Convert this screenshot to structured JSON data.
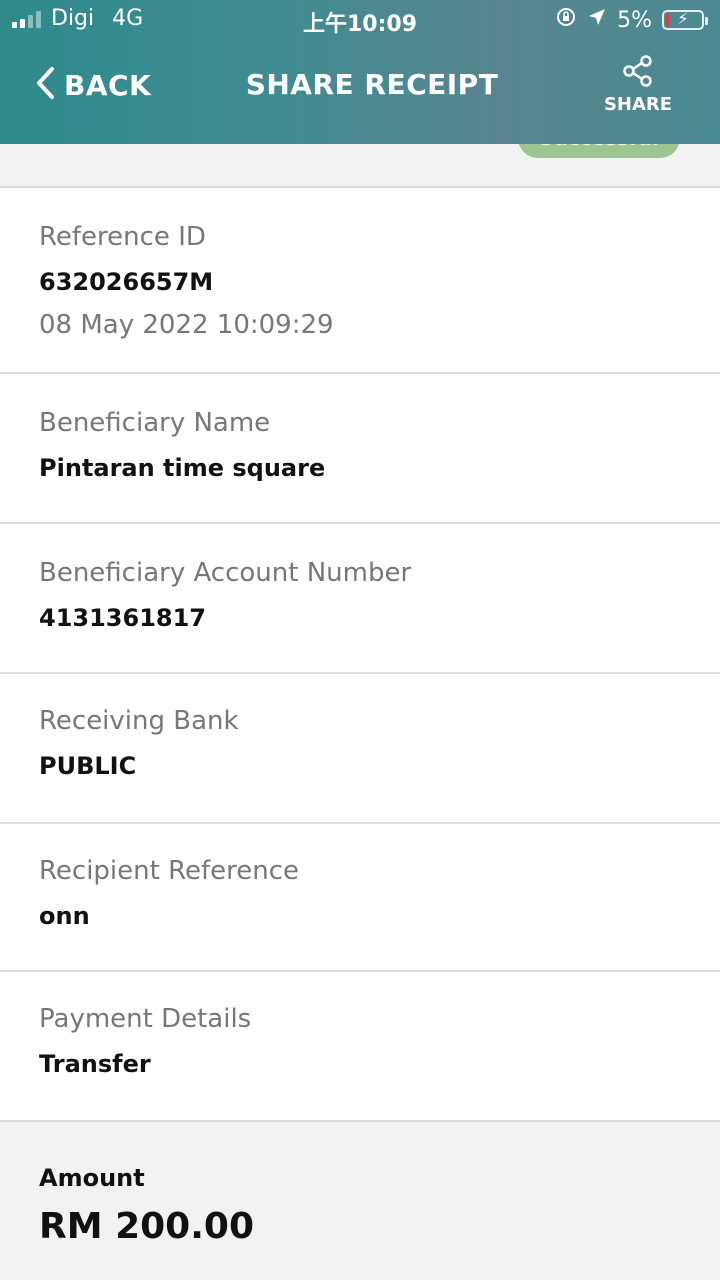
{
  "status_bar": {
    "carrier": "Digi",
    "network": "4G",
    "time": "上午10:09",
    "battery": "5%"
  },
  "nav": {
    "back_label": "BACK",
    "title": "SHARE RECEIPT",
    "share_label": "SHARE"
  },
  "status_badge": "Successful",
  "reference": {
    "label": "Reference ID",
    "value": "632026657M",
    "datetime": "08 May 2022 10:09:29"
  },
  "beneficiary_name": {
    "label": "Beneficiary Name",
    "value": "Pintaran time square"
  },
  "beneficiary_account": {
    "label": "Beneficiary Account Number",
    "value": "4131361817"
  },
  "receiving_bank": {
    "label": "Receiving Bank",
    "value": "PUBLIC"
  },
  "recipient_reference": {
    "label": "Recipient Reference",
    "value": "onn"
  },
  "payment_details": {
    "label": "Payment Details",
    "value": "Transfer"
  },
  "amount": {
    "label": "Amount",
    "value": "RM 200.00"
  },
  "colors": {
    "header": "#3f8c92",
    "badge": "#9cc591"
  }
}
